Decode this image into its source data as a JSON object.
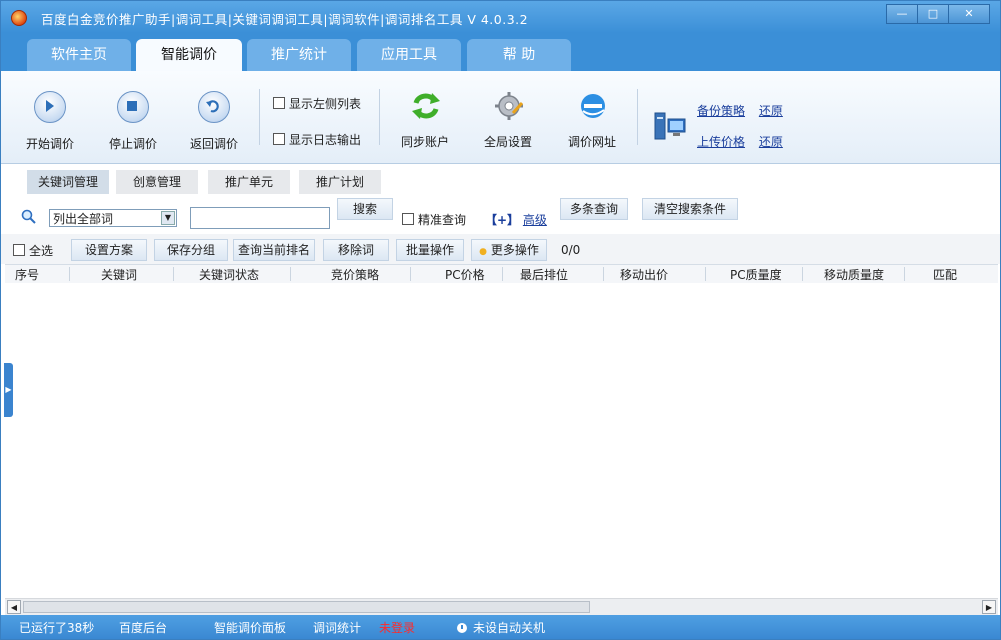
{
  "window": {
    "title": "百度白金竞价推广助手|调词工具|关键词调词工具|调词软件|调词排名工具   V 4.0.3.2"
  },
  "tabs": [
    {
      "label": "软件主页",
      "active": false
    },
    {
      "label": "智能调价",
      "active": true
    },
    {
      "label": "推广统计",
      "active": false
    },
    {
      "label": "应用工具",
      "active": false
    },
    {
      "label": "帮  助",
      "active": false
    }
  ],
  "ribbon": {
    "start": "开始调价",
    "stop": "停止调价",
    "back": "返回调价",
    "show_left": "显示左侧列表",
    "show_log": "显示日志输出",
    "sync": "同步账户",
    "global": "全局设置",
    "url": "调价网址",
    "backup": "备份策略",
    "restore1": "还原",
    "upload": "上传价格",
    "restore2": "还原"
  },
  "subtabs": [
    "关键词管理",
    "创意管理",
    "推广单元",
    "推广计划"
  ],
  "search": {
    "select_value": "列出全部词",
    "input_value": "",
    "search_btn": "搜索",
    "exact": "精准查询",
    "adv_prefix": "【+】",
    "adv": "高级",
    "multi": "多条查询",
    "clear": "清空搜索条件"
  },
  "actions": {
    "select_all": "全选",
    "scheme": "设置方案",
    "save_group": "保存分组",
    "query_rank": "查询当前排名",
    "remove": "移除词",
    "batch": "批量操作",
    "more": "更多操作",
    "count": "0/0"
  },
  "columns": [
    "序号",
    "关键词",
    "关键词状态",
    "竞价策略",
    "PC价格",
    "最后排位",
    "移动出价",
    "PC质量度",
    "移动质量度",
    "匹配"
  ],
  "status": {
    "runtime": "已运行了38秒",
    "backend": "百度后台",
    "panel": "智能调价面板",
    "stats": "调词统计",
    "login": "未登录",
    "shutdown": "未设自动关机"
  },
  "colors": {
    "accent": "#3b8fd7",
    "login_warning": "#ff2a2a",
    "link": "#1a3e9c"
  }
}
